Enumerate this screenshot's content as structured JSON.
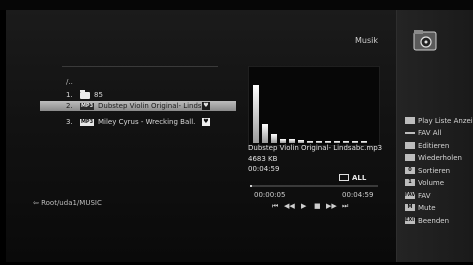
{
  "title": "Musik",
  "browser": {
    "parent": "/..",
    "rows": [
      {
        "num": "1.",
        "type": "folder",
        "label": "85"
      },
      {
        "num": "2.",
        "type": "MP3",
        "label": "Dubstep Violin Original- Linds",
        "heart": "♥"
      },
      {
        "num": "3.",
        "type": "MP3",
        "label": "Miley Cyrus - Wrecking Ball.",
        "heart": "♥"
      }
    ],
    "path": "⇦ Root/uda1/MUSIC"
  },
  "player": {
    "song_name": "Dubstep Violin Original- Lindsabc.mp3",
    "song_size": "4683 KB",
    "song_duration": "00:04:59",
    "repeat_label": "ALL",
    "time_elapsed": "00:00:05",
    "time_total": "00:04:59",
    "progress": 0.017,
    "controls": [
      "⏮",
      "◀◀",
      "▶",
      "■",
      "▶▶",
      "⏭"
    ],
    "spectrum_levels": [
      0.78,
      0.25,
      0.12,
      0.06,
      0.05,
      0.04,
      0.03,
      0.03,
      0.02,
      0.02,
      0.02,
      0.02,
      0.02
    ]
  },
  "menu": [
    {
      "icon": "",
      "label": "Play Liste Anzeigen"
    },
    {
      "icon": "",
      "label": "FAV All",
      "dash": true
    },
    {
      "icon": "",
      "label": "Editieren"
    },
    {
      "icon": "",
      "label": "Wiederholen"
    },
    {
      "icon": "0",
      "label": "Sortieren"
    },
    {
      "icon": "1",
      "label": "Volume"
    },
    {
      "icon": "FAV",
      "label": "FAV"
    },
    {
      "icon": "M",
      "label": "Mute"
    },
    {
      "icon": "EXIT",
      "label": "Beenden"
    }
  ],
  "colors": {
    "accent": "#cfcfcf",
    "background": "#000000",
    "highlight": "#bdbdbd"
  }
}
